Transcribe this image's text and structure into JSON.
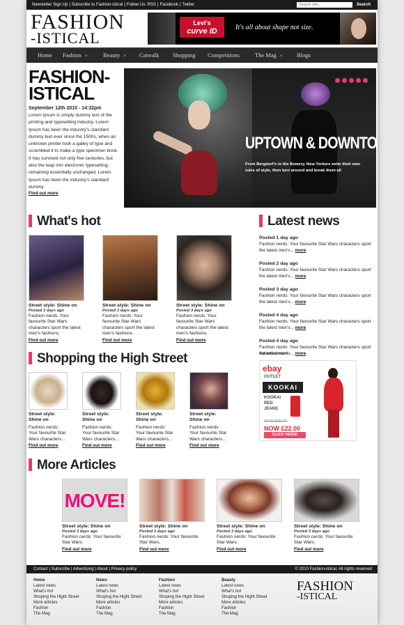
{
  "topbar": {
    "links": [
      "Newsletter Sign Up",
      "Subscribe to Fashion-istical",
      "Follow Us: RSS",
      "Facebook",
      "Twitter"
    ],
    "search_placeholder": "Search site...",
    "search_button": "Search"
  },
  "logo": {
    "line1": "FASHION",
    "line2": "-ISTICAL"
  },
  "banner": {
    "brand_top": "Levi's",
    "brand_bottom": "curve ID",
    "tagline": "It's all about shape not size."
  },
  "nav": [
    {
      "label": "Home",
      "dropdown": false
    },
    {
      "label": "Fashion",
      "dropdown": true
    },
    {
      "label": "Beauty",
      "dropdown": true
    },
    {
      "label": "Catwalk",
      "dropdown": false
    },
    {
      "label": "Shopping",
      "dropdown": false
    },
    {
      "label": "Competitions",
      "dropdown": false
    },
    {
      "label": "The Mag",
      "dropdown": true
    },
    {
      "label": "Blogs",
      "dropdown": false
    }
  ],
  "hero": {
    "logo_line1": "FASHION-",
    "logo_line2": "ISTICAL",
    "date": "September 12th 2010 - 14:32pm",
    "body": "Lorem Ipsum is simply dummy text of the printing and typesetting industry. Lorem Ipsum has been the industry's standard dummy text ever since the 1500s, when an unknown printer took a galley of type and scrambled it to make a type specimen book. It has survived not only five centuries, but also the leap into electronic typesetting, remaining essentially unchanged. Lorem Ipsum has been the industry's standard dummy.",
    "more": "Find out more",
    "headline": "UPTOWN & DOWNTOWN",
    "subhead": "From Bergdorf's to the Bowery, New Yorkers write their own rules of style, then turn around and break them all",
    "accent": "#e33c6c"
  },
  "sections": {
    "whats_hot": "What's hot",
    "latest_news": "Latest news",
    "shopping": "Shopping the High Street",
    "more_articles": "More Articles"
  },
  "whats_hot": [
    {
      "title": "Street style: Shine on",
      "posted": "Posted 3 days ago",
      "desc": "Fashion nerds: Your favourite Star Wars characters sport the latest men's fashions.",
      "more": "Find out more"
    },
    {
      "title": "Street style: Shine on",
      "posted": "Posted 3 days ago",
      "desc": "Fashion nerds: Your favourite Star Wars characters sport the latest men's fashions.",
      "more": "Find out more"
    },
    {
      "title": "Street style: Shine on",
      "posted": "Posted 3 days ago",
      "desc": "Fashion nerds: Your favourite Star Wars characters sport the latest men's fashions.",
      "more": "Find out more"
    }
  ],
  "latest_news": [
    {
      "posted": "Posted 1 day ago",
      "text": "Fashion nerds: Your favourite Star Wars characters sport the latest men's...",
      "more": "more"
    },
    {
      "posted": "Posted 2 day ago",
      "text": "Fashion nerds: Your favourite Star Wars characters sport the latest men's...",
      "more": "more"
    },
    {
      "posted": "Posted 3 day ago",
      "text": "Fashion nerds: Your favourite Star Wars characters sport the latest men's...",
      "more": "more"
    },
    {
      "posted": "Posted 4 day ago",
      "text": "Fashion nerds: Your favourite Star Wars characters sport the latest men's...",
      "more": "more"
    },
    {
      "posted": "Posted 4 day ago",
      "text": "Fashion nerds: Your favourite Star Wars characters sport the latest men's...",
      "more": "more"
    }
  ],
  "shopping": [
    {
      "title": "Street style: Shine on",
      "desc": "Fashion nerds: Your favourite Star Wars characters...",
      "more": "Find out more"
    },
    {
      "title": "Street style: Shine on",
      "desc": "Fashion nerds: Your favourite Star Wars characters...",
      "more": "Find out more"
    },
    {
      "title": "Street style: Shine on",
      "desc": "Fashion nerds: Your favourite Star Wars characters...",
      "more": "Find out more"
    },
    {
      "title": "Street style: Shine on",
      "desc": "Fashion nerds: Your favourite Star Wars characters...",
      "more": "Find out more"
    }
  ],
  "advert": {
    "label": "Advertisement",
    "ebay": "ebay",
    "outlet": "OUTLET",
    "brand": "KOOKAI",
    "line1": "KOOKAI",
    "line2": "RED",
    "line3": "JEANS",
    "was": "WAS £55.00",
    "now": "NOW £22.00",
    "cta": "CLICK HERE!"
  },
  "more_articles": [
    {
      "img_text": "MOVE!",
      "title": "Street style: Shine on",
      "posted": "Posted 3 days ago",
      "desc": "Fashion nerds: Your favourite Star Wars.",
      "more": "Find out more"
    },
    {
      "img_text": "",
      "title": "Street style: Shine on",
      "posted": "Posted 3 days ago",
      "desc": "Fashion nerds: Your favourite Star Wars.",
      "more": "Find out more"
    },
    {
      "img_text": "",
      "title": "Street style: Shine on",
      "posted": "Posted 3 days ago",
      "desc": "Fashion nerds: Your favourite Star Wars.",
      "more": "Find out more"
    },
    {
      "img_text": "",
      "title": "Street style: Shine on",
      "posted": "Posted 3 days ago",
      "desc": "Fashion nerds: Your favourite Star Wars.",
      "more": "Find out more"
    }
  ],
  "footer": {
    "links": [
      "Contact",
      "Subscribe",
      "Advertising",
      "About",
      "Privacy policy"
    ],
    "copyright": "© 2010 Fashion-istical, All rights reserved",
    "columns": [
      {
        "heading": "Home",
        "items": [
          "Latest news",
          "What's hot",
          "Shoping the Hight Street",
          "More articles",
          "Fashion",
          "The Mag"
        ]
      },
      {
        "heading": "News",
        "items": [
          "Latest news",
          "What's hot",
          "Shoping the Hight Street",
          "More articles",
          "Fashion",
          "The Mag"
        ]
      },
      {
        "heading": "Fashion",
        "items": [
          "Latest news",
          "What's hot",
          "Shoping the Hight Street",
          "More articles",
          "Fashion",
          "The Mag"
        ]
      },
      {
        "heading": "Beauty",
        "items": [
          "Latest news",
          "What's hot",
          "Shoping the Hight Street",
          "More articles",
          "Fashion",
          "The Mag"
        ]
      }
    ],
    "logo_line1": "FASHION",
    "logo_line2": "-ISTICAL"
  }
}
